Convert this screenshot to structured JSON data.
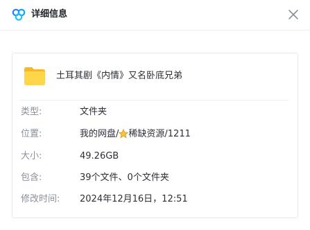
{
  "header": {
    "title": "详细信息",
    "app_icon": "cloud-logo-icon",
    "close_icon": "close-icon"
  },
  "file": {
    "icon": "folder-icon",
    "name": "土耳其剧《内情》又名卧底兄弟"
  },
  "details": [
    {
      "label": "类型:",
      "value": "文件夹"
    },
    {
      "label": "位置:",
      "value_prefix": "我的网盘/",
      "value_icon": "star-icon",
      "value_suffix": "稀缺资源/1211"
    },
    {
      "label": "大小:",
      "value": "49.26GB"
    },
    {
      "label": "包含:",
      "value": "39个文件、0个文件夹"
    },
    {
      "label": "修改时间:",
      "value": "2024年12月16日，12:51"
    }
  ],
  "colors": {
    "accent": "#06a7ff",
    "folder": "#ffd54a",
    "star": "#f6c343"
  }
}
